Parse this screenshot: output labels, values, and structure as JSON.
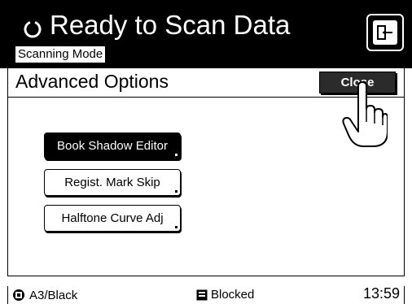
{
  "header": {
    "title": "Ready to Scan Data",
    "mode": "Scanning Mode",
    "status_icon": "refresh-icon",
    "exit_icon": "exit-icon"
  },
  "panel": {
    "title": "Advanced Options",
    "close_label": "Close"
  },
  "options": [
    {
      "label": "Book Shadow Editor",
      "active": true
    },
    {
      "label": "Regist. Mark Skip",
      "active": false
    },
    {
      "label": "Halftone Curve Adj",
      "active": false
    }
  ],
  "status": {
    "paper": "A3/Black",
    "paper_icon": "paper-tray-icon",
    "state": "Blocked",
    "state_icon": "memory-icon",
    "time": "13:59"
  },
  "colors": {
    "header_bg": "#000000",
    "active_button_bg": "#000000",
    "close_button_bg": "#2b2b2b"
  }
}
